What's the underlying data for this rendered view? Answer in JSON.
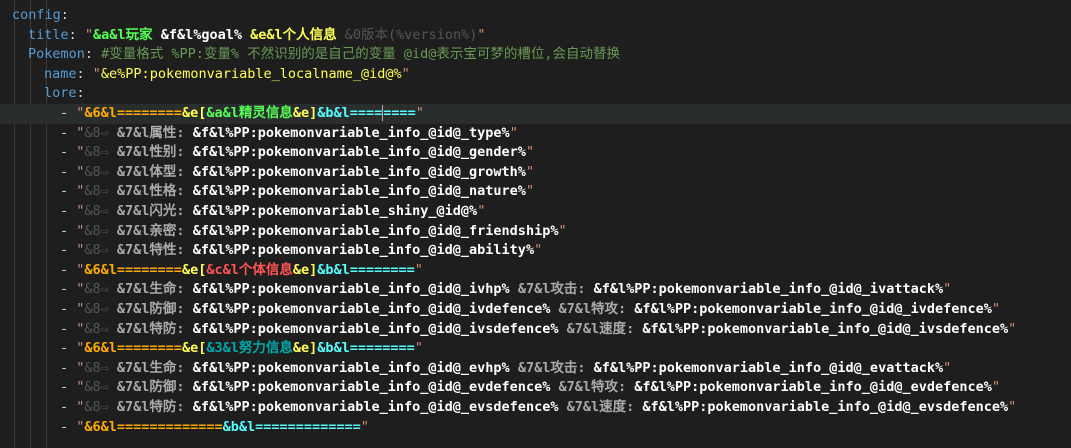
{
  "lines": [
    [
      {
        "t": "config",
        "c": "#569cd6"
      },
      {
        "t": ":",
        "c": "#d4d4d4"
      }
    ],
    [
      {
        "t": "title",
        "c": "#569cd6"
      },
      {
        "t": ": ",
        "c": "#d4d4d4"
      },
      {
        "t": "\"",
        "c": "#ce9178"
      },
      {
        "t": "&a&l玩家 ",
        "c": "#55ff55",
        "b": 1
      },
      {
        "t": "&f&l%goal% ",
        "c": "#ffffff",
        "b": 1
      },
      {
        "t": "&e&l个人信息 ",
        "c": "#ffff55",
        "b": 1
      },
      {
        "t": "&0版本(%version%)",
        "c": "#555555"
      },
      {
        "t": "\"",
        "c": "#ce9178"
      }
    ],
    [
      {
        "t": "Pokemon",
        "c": "#569cd6"
      },
      {
        "t": ": ",
        "c": "#d4d4d4"
      },
      {
        "t": "#变量格式 %PP:变量% 不然识别的是自己的变量 @id@表示宝可梦的槽位,会自动替换",
        "c": "#6a9955"
      }
    ],
    [
      {
        "t": "name",
        "c": "#569cd6"
      },
      {
        "t": ": ",
        "c": "#d4d4d4"
      },
      {
        "t": "\"",
        "c": "#ce9178"
      },
      {
        "t": "&e%PP:pokemonvariable_localname_@id@%",
        "c": "#ffff55"
      },
      {
        "t": "\"",
        "c": "#ce9178"
      }
    ],
    [
      {
        "t": "lore",
        "c": "#569cd6"
      },
      {
        "t": ":",
        "c": "#d4d4d4"
      }
    ],
    [
      {
        "t": "- ",
        "c": "#d4d4d4"
      },
      {
        "t": "\"",
        "c": "#ce9178"
      },
      {
        "t": "&6&l========",
        "c": "#ffaa00",
        "b": 1
      },
      {
        "t": "&e[",
        "c": "#ffff55",
        "b": 1
      },
      {
        "t": "&a&l精灵信息",
        "c": "#55ff55",
        "b": 1
      },
      {
        "t": "&e]",
        "c": "#ffff55",
        "b": 1
      },
      {
        "t": "&b&l====",
        "c": "#55ffff",
        "b": 1
      },
      {
        "t": "CARET"
      },
      {
        "t": "====",
        "c": "#55ffff",
        "b": 1
      },
      {
        "t": "\"",
        "c": "#ce9178"
      }
    ],
    [
      {
        "t": "- ",
        "c": "#d4d4d4"
      },
      {
        "t": "\"",
        "c": "#ce9178"
      },
      {
        "t": "&8⇨ ",
        "c": "#555555"
      },
      {
        "t": "&7&l属性: ",
        "c": "#aaaaaa",
        "b": 1
      },
      {
        "t": "&f&l%PP:pokemonvariable_info_@id@_type%",
        "c": "#ffffff",
        "b": 1
      },
      {
        "t": "\"",
        "c": "#ce9178"
      }
    ],
    [
      {
        "t": "- ",
        "c": "#d4d4d4"
      },
      {
        "t": "\"",
        "c": "#ce9178"
      },
      {
        "t": "&8⇨ ",
        "c": "#555555"
      },
      {
        "t": "&7&l性别: ",
        "c": "#aaaaaa",
        "b": 1
      },
      {
        "t": "&f&l%PP:pokemonvariable_info_@id@_gender%",
        "c": "#ffffff",
        "b": 1
      },
      {
        "t": "\"",
        "c": "#ce9178"
      }
    ],
    [
      {
        "t": "- ",
        "c": "#d4d4d4"
      },
      {
        "t": "\"",
        "c": "#ce9178"
      },
      {
        "t": "&8⇨ ",
        "c": "#555555"
      },
      {
        "t": "&7&l体型: ",
        "c": "#aaaaaa",
        "b": 1
      },
      {
        "t": "&f&l%PP:pokemonvariable_info_@id@_growth%",
        "c": "#ffffff",
        "b": 1
      },
      {
        "t": "\"",
        "c": "#ce9178"
      }
    ],
    [
      {
        "t": "- ",
        "c": "#d4d4d4"
      },
      {
        "t": "\"",
        "c": "#ce9178"
      },
      {
        "t": "&8⇨ ",
        "c": "#555555"
      },
      {
        "t": "&7&l性格: ",
        "c": "#aaaaaa",
        "b": 1
      },
      {
        "t": "&f&l%PP:pokemonvariable_info_@id@_nature%",
        "c": "#ffffff",
        "b": 1
      },
      {
        "t": "\"",
        "c": "#ce9178"
      }
    ],
    [
      {
        "t": "- ",
        "c": "#d4d4d4"
      },
      {
        "t": "\"",
        "c": "#ce9178"
      },
      {
        "t": "&8⇨ ",
        "c": "#555555"
      },
      {
        "t": "&7&l闪光: ",
        "c": "#aaaaaa",
        "b": 1
      },
      {
        "t": "&f&l%PP:pokemonvariable_shiny_@id@%",
        "c": "#ffffff",
        "b": 1
      },
      {
        "t": "\"",
        "c": "#ce9178"
      }
    ],
    [
      {
        "t": "- ",
        "c": "#d4d4d4"
      },
      {
        "t": "\"",
        "c": "#ce9178"
      },
      {
        "t": "&8⇨ ",
        "c": "#555555"
      },
      {
        "t": "&7&l亲密: ",
        "c": "#aaaaaa",
        "b": 1
      },
      {
        "t": "&f&l%PP:pokemonvariable_info_@id@_friendship%",
        "c": "#ffffff",
        "b": 1
      },
      {
        "t": "\"",
        "c": "#ce9178"
      }
    ],
    [
      {
        "t": "- ",
        "c": "#d4d4d4"
      },
      {
        "t": "\"",
        "c": "#ce9178"
      },
      {
        "t": "&8⇨ ",
        "c": "#555555"
      },
      {
        "t": "&7&l特性: ",
        "c": "#aaaaaa",
        "b": 1
      },
      {
        "t": "&f&l%PP:pokemonvariable_info_@id@_ability%",
        "c": "#ffffff",
        "b": 1
      },
      {
        "t": "\"",
        "c": "#ce9178"
      }
    ],
    [
      {
        "t": "- ",
        "c": "#d4d4d4"
      },
      {
        "t": "\"",
        "c": "#ce9178"
      },
      {
        "t": "&6&l========",
        "c": "#ffaa00",
        "b": 1
      },
      {
        "t": "&e[",
        "c": "#ffff55",
        "b": 1
      },
      {
        "t": "&c&l个体信息",
        "c": "#ff5555",
        "b": 1
      },
      {
        "t": "&e]",
        "c": "#ffff55",
        "b": 1
      },
      {
        "t": "&b&l========",
        "c": "#55ffff",
        "b": 1
      },
      {
        "t": "\"",
        "c": "#ce9178"
      }
    ],
    [
      {
        "t": "- ",
        "c": "#d4d4d4"
      },
      {
        "t": "\"",
        "c": "#ce9178"
      },
      {
        "t": "&8⇨ ",
        "c": "#555555"
      },
      {
        "t": "&7&l生命: ",
        "c": "#aaaaaa",
        "b": 1
      },
      {
        "t": "&f&l%PP:pokemonvariable_info_@id@_ivhp% ",
        "c": "#ffffff",
        "b": 1
      },
      {
        "t": "&7&l攻击: ",
        "c": "#aaaaaa",
        "b": 1
      },
      {
        "t": "&f&l%PP:pokemonvariable_info_@id@_ivattack%",
        "c": "#ffffff",
        "b": 1
      },
      {
        "t": "\"",
        "c": "#ce9178"
      }
    ],
    [
      {
        "t": "- ",
        "c": "#d4d4d4"
      },
      {
        "t": "\"",
        "c": "#ce9178"
      },
      {
        "t": "&8⇨ ",
        "c": "#555555"
      },
      {
        "t": "&7&l防御: ",
        "c": "#aaaaaa",
        "b": 1
      },
      {
        "t": "&f&l%PP:pokemonvariable_info_@id@_ivdefence% ",
        "c": "#ffffff",
        "b": 1
      },
      {
        "t": "&7&l特攻: ",
        "c": "#aaaaaa",
        "b": 1
      },
      {
        "t": "&f&l%PP:pokemonvariable_info_@id@_ivdefence%",
        "c": "#ffffff",
        "b": 1
      },
      {
        "t": "\"",
        "c": "#ce9178"
      }
    ],
    [
      {
        "t": "- ",
        "c": "#d4d4d4"
      },
      {
        "t": "\"",
        "c": "#ce9178"
      },
      {
        "t": "&8⇨ ",
        "c": "#555555"
      },
      {
        "t": "&7&l特防: ",
        "c": "#aaaaaa",
        "b": 1
      },
      {
        "t": "&f&l%PP:pokemonvariable_info_@id@_ivsdefence% ",
        "c": "#ffffff",
        "b": 1
      },
      {
        "t": "&7&l速度: ",
        "c": "#aaaaaa",
        "b": 1
      },
      {
        "t": "&f&l%PP:pokemonvariable_info_@id@_ivsdefence%",
        "c": "#ffffff",
        "b": 1
      },
      {
        "t": "\"",
        "c": "#ce9178"
      }
    ],
    [
      {
        "t": "- ",
        "c": "#d4d4d4"
      },
      {
        "t": "\"",
        "c": "#ce9178"
      },
      {
        "t": "&6&l========",
        "c": "#ffaa00",
        "b": 1
      },
      {
        "t": "&e[",
        "c": "#ffff55",
        "b": 1
      },
      {
        "t": "&3&l努力信息",
        "c": "#00aaaa",
        "b": 1
      },
      {
        "t": "&e]",
        "c": "#ffff55",
        "b": 1
      },
      {
        "t": "&b&l========",
        "c": "#55ffff",
        "b": 1
      },
      {
        "t": "\"",
        "c": "#ce9178"
      }
    ],
    [
      {
        "t": "- ",
        "c": "#d4d4d4"
      },
      {
        "t": "\"",
        "c": "#ce9178"
      },
      {
        "t": "&8⇨ ",
        "c": "#555555"
      },
      {
        "t": "&7&l生命: ",
        "c": "#aaaaaa",
        "b": 1
      },
      {
        "t": "&f&l%PP:pokemonvariable_info_@id@_evhp% ",
        "c": "#ffffff",
        "b": 1
      },
      {
        "t": "&7&l攻击: ",
        "c": "#aaaaaa",
        "b": 1
      },
      {
        "t": "&f&l%PP:pokemonvariable_info_@id@_evattack%",
        "c": "#ffffff",
        "b": 1
      },
      {
        "t": "\"",
        "c": "#ce9178"
      }
    ],
    [
      {
        "t": "- ",
        "c": "#d4d4d4"
      },
      {
        "t": "\"",
        "c": "#ce9178"
      },
      {
        "t": "&8⇨ ",
        "c": "#555555"
      },
      {
        "t": "&7&l防御: ",
        "c": "#aaaaaa",
        "b": 1
      },
      {
        "t": "&f&l%PP:pokemonvariable_info_@id@_evdefence% ",
        "c": "#ffffff",
        "b": 1
      },
      {
        "t": "&7&l特攻: ",
        "c": "#aaaaaa",
        "b": 1
      },
      {
        "t": "&f&l%PP:pokemonvariable_info_@id@_evdefence%",
        "c": "#ffffff",
        "b": 1
      },
      {
        "t": "\"",
        "c": "#ce9178"
      }
    ],
    [
      {
        "t": "- ",
        "c": "#d4d4d4"
      },
      {
        "t": "\"",
        "c": "#ce9178"
      },
      {
        "t": "&8⇨ ",
        "c": "#555555"
      },
      {
        "t": "&7&l特防: ",
        "c": "#aaaaaa",
        "b": 1
      },
      {
        "t": "&f&l%PP:pokemonvariable_info_@id@_evsdefence% ",
        "c": "#ffffff",
        "b": 1
      },
      {
        "t": "&7&l速度: ",
        "c": "#aaaaaa",
        "b": 1
      },
      {
        "t": "&f&l%PP:pokemonvariable_info_@id@_evsdefence%",
        "c": "#ffffff",
        "b": 1
      },
      {
        "t": "\"",
        "c": "#ce9178"
      }
    ],
    [
      {
        "t": "- ",
        "c": "#d4d4d4"
      },
      {
        "t": "\"",
        "c": "#ce9178"
      },
      {
        "t": "&6&l=============",
        "c": "#ffaa00",
        "b": 1
      },
      {
        "t": "&b&l=============",
        "c": "#55ffff",
        "b": 1
      },
      {
        "t": "\"",
        "c": "#ce9178"
      }
    ]
  ]
}
